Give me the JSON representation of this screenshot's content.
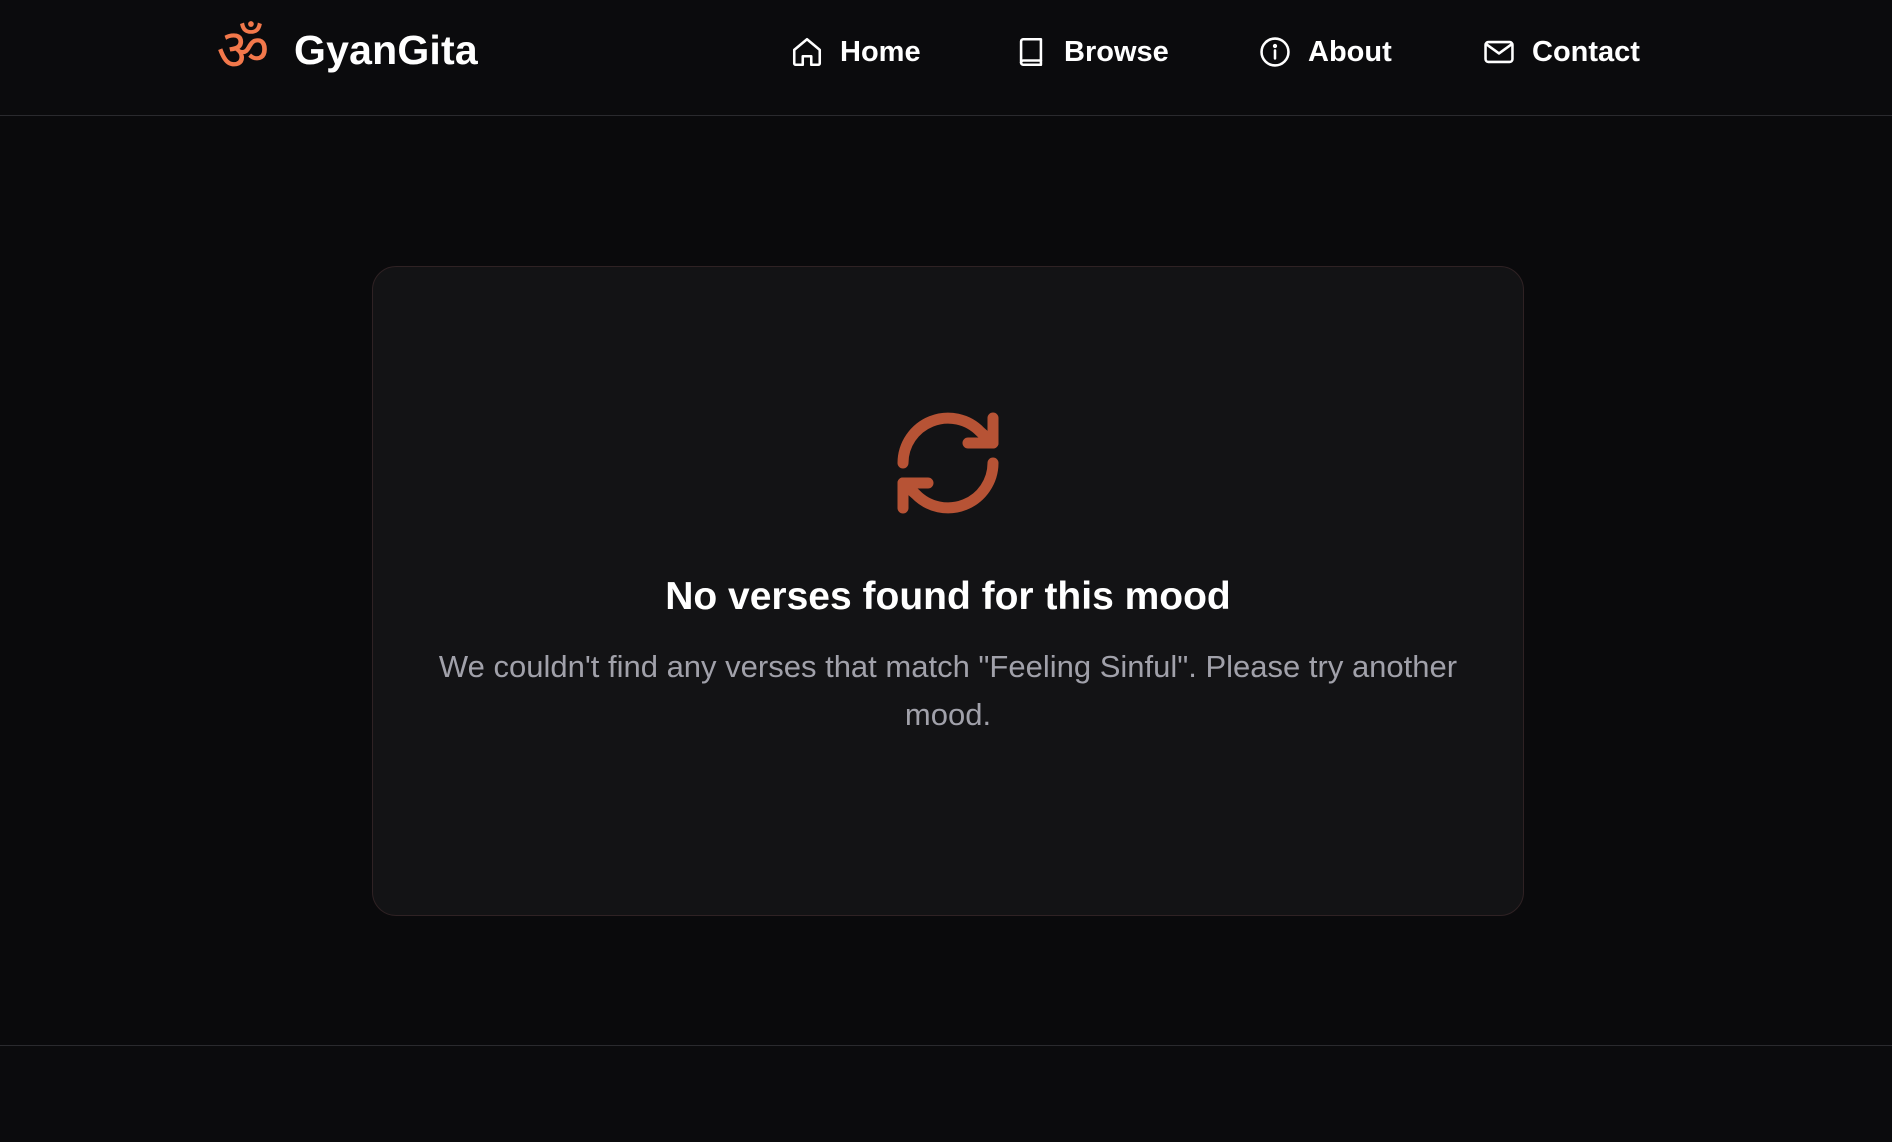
{
  "colors": {
    "accent": "#f2784b",
    "background": "#0a0a0c",
    "card": "#131315",
    "muted_text": "#a1a1aa"
  },
  "brand": {
    "logo_glyph": "ॐ",
    "logo_icon": "om-icon",
    "name": "GyanGita"
  },
  "nav": {
    "items": [
      {
        "label": "Home",
        "icon": "home-icon"
      },
      {
        "label": "Browse",
        "icon": "book-icon"
      },
      {
        "label": "About",
        "icon": "info-icon"
      },
      {
        "label": "Contact",
        "icon": "mail-icon"
      }
    ]
  },
  "empty_state": {
    "icon": "refresh-icon",
    "title": "No verses found for this mood",
    "description": "We couldn't find any verses that match \"Feeling Sinful\". Please try another mood."
  }
}
